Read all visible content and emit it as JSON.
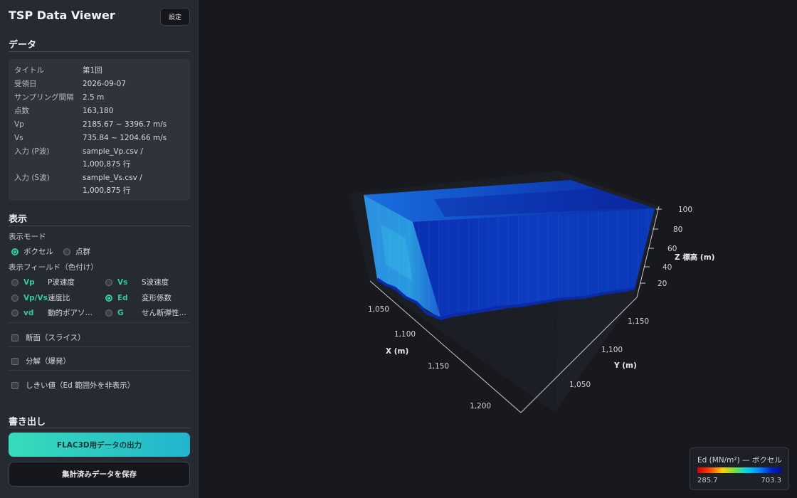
{
  "app": {
    "title": "TSP Data Viewer",
    "settings_label": "設定"
  },
  "data_section": {
    "heading": "データ",
    "rows": [
      {
        "key": "タイトル",
        "value": "第1回"
      },
      {
        "key": "受領日",
        "value": "2026-09-07"
      },
      {
        "key": "サンプリング間隔",
        "value": "2.5 m"
      },
      {
        "key": "点数",
        "value": "163,180"
      },
      {
        "key": "Vp",
        "value": "2185.67 ~ 3396.7 m/s"
      },
      {
        "key": "Vs",
        "value": "735.84 ~ 1204.66 m/s"
      },
      {
        "key": "入力 (P波)",
        "value": "sample_Vp.csv / 1,000,875 行"
      },
      {
        "key": "入力 (S波)",
        "value": "sample_Vs.csv / 1,000,875 行"
      }
    ]
  },
  "display_section": {
    "heading": "表示",
    "mode_label": "表示モード",
    "modes": [
      "ボクセル",
      "点群"
    ],
    "selected_mode": "ボクセル",
    "field_label": "表示フィールド（色付け）",
    "fields": [
      {
        "code": "Vp",
        "desc": "P波速度"
      },
      {
        "code": "Vs",
        "desc": "S波速度"
      },
      {
        "code": "Vp/Vs",
        "desc": "速度比"
      },
      {
        "code": "Ed",
        "desc": "変形係数"
      },
      {
        "code": "vd",
        "desc": "動的ポアソ…"
      },
      {
        "code": "G",
        "desc": "せん断弾性…"
      }
    ],
    "selected_field": "Ed",
    "checkboxes": [
      {
        "label": "断面（スライス）",
        "checked": false
      },
      {
        "label": "分解（爆発）",
        "checked": false
      },
      {
        "label": "しきい値（Ed 範囲外を非表示）",
        "checked": false
      }
    ]
  },
  "export_section": {
    "heading": "書き出し",
    "flac_button": "FLAC3D用データの出力",
    "save_button": "集計済みデータを保存"
  },
  "plot": {
    "x_axis": {
      "title": "X (m)",
      "ticks": [
        "1,050",
        "1,100",
        "1,150",
        "1,200"
      ]
    },
    "y_axis": {
      "title": "Y (m)",
      "ticks": [
        "1,050",
        "1,100",
        "1,150"
      ]
    },
    "z_axis": {
      "title": "Z 標高 (m)",
      "ticks": [
        "20",
        "40",
        "60",
        "80",
        "100"
      ]
    },
    "colors": {
      "top": "#1546c4",
      "front": "#0a2aa8",
      "left": "#1f78d8",
      "pane": "#1a1d23",
      "axis": "#c9ccd2"
    }
  },
  "legend": {
    "title": "Ed (MN/m²) — ボクセル",
    "min": "285.7",
    "max": "703.3"
  }
}
